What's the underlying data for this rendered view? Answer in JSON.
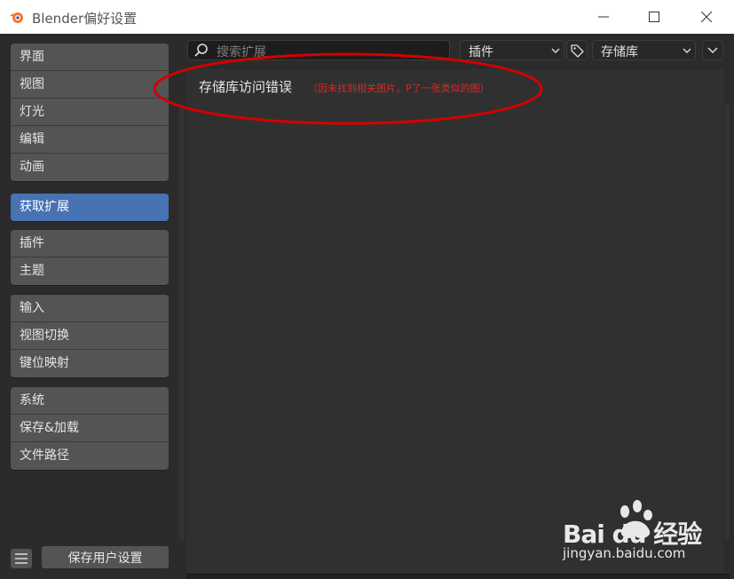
{
  "window": {
    "title": "Blender偏好设置"
  },
  "sidebar": {
    "groups": [
      {
        "items": [
          {
            "label": "界面"
          },
          {
            "label": "视图"
          },
          {
            "label": "灯光"
          },
          {
            "label": "编辑"
          },
          {
            "label": "动画"
          }
        ]
      },
      {
        "items": [
          {
            "label": "获取扩展",
            "active": true
          }
        ]
      },
      {
        "items": [
          {
            "label": "插件"
          },
          {
            "label": "主题"
          }
        ]
      },
      {
        "items": [
          {
            "label": "输入"
          },
          {
            "label": "视图切换"
          },
          {
            "label": "键位映射"
          }
        ]
      },
      {
        "items": [
          {
            "label": "系统"
          },
          {
            "label": "保存&加载"
          },
          {
            "label": "文件路径"
          }
        ]
      }
    ],
    "save_button": "保存用户设置"
  },
  "toolbar": {
    "search_placeholder": "搜索扩展",
    "type_dropdown": "插件",
    "repo_dropdown": "存储库"
  },
  "content": {
    "error_message": "存储库访问错误",
    "annotation_note": "（因未找到相关图片，P了一张类似的图）"
  },
  "watermark": {
    "brand": "Bai du 经验",
    "url": "jingyan.baidu.com"
  },
  "colors": {
    "active": "#4772b3",
    "annotation": "#d42a2a"
  }
}
